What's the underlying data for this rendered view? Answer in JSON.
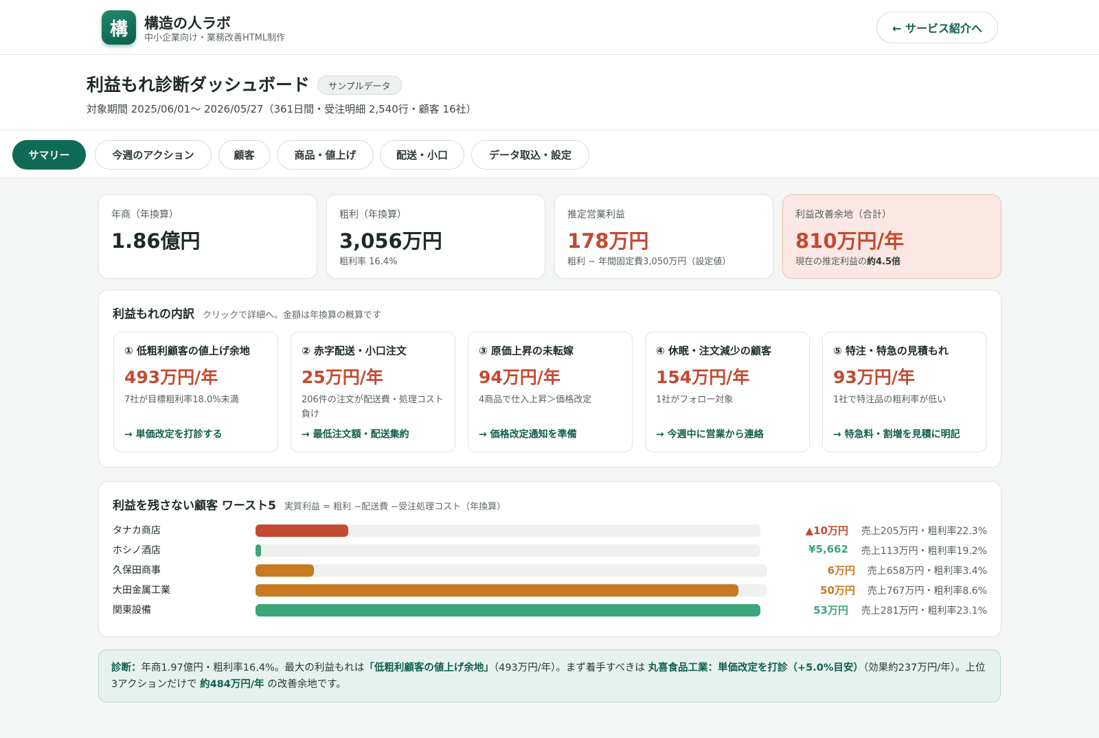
{
  "brand": {
    "logo_char": "構",
    "name": "構造の人ラボ",
    "subtitle": "中小企業向け・業務改善HTML制作"
  },
  "header": {
    "back_label": "← サービス紹介へ"
  },
  "page": {
    "title": "利益もれ診断ダッシュボード",
    "badge": "サンプルデータ",
    "period": "対象期間 2025/06/01〜 2026/05/27（361日間・受注明細 2,540行・顧客 16社）"
  },
  "tabs": [
    {
      "label": "サマリー",
      "active": true
    },
    {
      "label": "今週のアクション"
    },
    {
      "label": "顧客"
    },
    {
      "label": "商品・値上げ"
    },
    {
      "label": "配送・小口"
    },
    {
      "label": "データ取込・設定"
    }
  ],
  "kpis": [
    {
      "label": "年商（年換算）",
      "value": "1.86億円",
      "sub": ""
    },
    {
      "label": "粗利（年換算）",
      "value": "3,056万円",
      "sub": "粗利率 16.4%"
    },
    {
      "label": "推定営業利益",
      "value": "178万円",
      "sub": "粗利 − 年間固定費3,050万円（設定値）"
    },
    {
      "label": "利益改善余地（合計）",
      "value": "810万円/年",
      "sub_prefix": "現在の推定利益の",
      "sub_strong": "約4.5倍"
    }
  ],
  "breakdown": {
    "title": "利益もれの内訳",
    "note": "クリックで詳細へ。金額は年換算の概算です",
    "items": [
      {
        "title": "① 低粗利顧客の値上げ余地",
        "value": "493万円/年",
        "desc": "7社が目標粗利率18.0%未満",
        "action": "→ 単価改定を打診する"
      },
      {
        "title": "② 赤字配送・小口注文",
        "value": "25万円/年",
        "desc": "206件の注文が配送費・処理コスト負け",
        "action": "→ 最低注文額・配送集約"
      },
      {
        "title": "③ 原価上昇の未転嫁",
        "value": "94万円/年",
        "desc": "4商品で仕入上昇＞価格改定",
        "action": "→ 価格改定通知を準備"
      },
      {
        "title": "④ 休眠・注文減少の顧客",
        "value": "154万円/年",
        "desc": "1社がフォロー対象",
        "action": "→ 今週中に営業から連絡"
      },
      {
        "title": "⑤ 特注・特急の見積もれ",
        "value": "93万円/年",
        "desc": "1社で特注品の粗利率が低い",
        "action": "→ 特急料・割増を見積に明記"
      }
    ]
  },
  "worst": {
    "title": "利益を残さない顧客 ワースト5",
    "note": "実質利益 = 粗利 −配送費 −受注処理コスト（年換算）",
    "rows": [
      {
        "name": "タナカ商店",
        "value": "▲10万円",
        "meta": "売上205万円・粗利率22.3%",
        "fraction": 0.183,
        "color": "#c44a31"
      },
      {
        "name": "ホシノ酒店",
        "value": "¥5,662",
        "meta": "売上113万円・粗利率19.2%",
        "fraction": 0.011,
        "color": "#3aa67b"
      },
      {
        "name": "久保田商事",
        "value": "6万円",
        "meta": "売上658万円・粗利率3.4%",
        "fraction": 0.114,
        "color": "#c77a22"
      },
      {
        "name": "大田金属工業",
        "value": "50万円",
        "meta": "売上767万円・粗利率8.6%",
        "fraction": 0.943,
        "color": "#c77a22"
      },
      {
        "name": "関東設備",
        "value": "53万円",
        "meta": "売上281万円・粗利率23.1%",
        "fraction": 1.0,
        "color": "#3aa67b"
      }
    ]
  },
  "diagnosis": {
    "label": "診断：",
    "t1": "年商1.97億円・粗利率16.4%。最大の利益もれは",
    "s1": "「低粗利顧客の値上げ余地」",
    "t2": "（493万円/年）。まず着手すべきは ",
    "s2": "丸喜食品工業：単価改定を打診（+5.0%目安）",
    "t3": "（効果約237万円/年）。上位3アクションだけで ",
    "s3": "約484万円/年",
    "t4": " の改善余地です。"
  }
}
